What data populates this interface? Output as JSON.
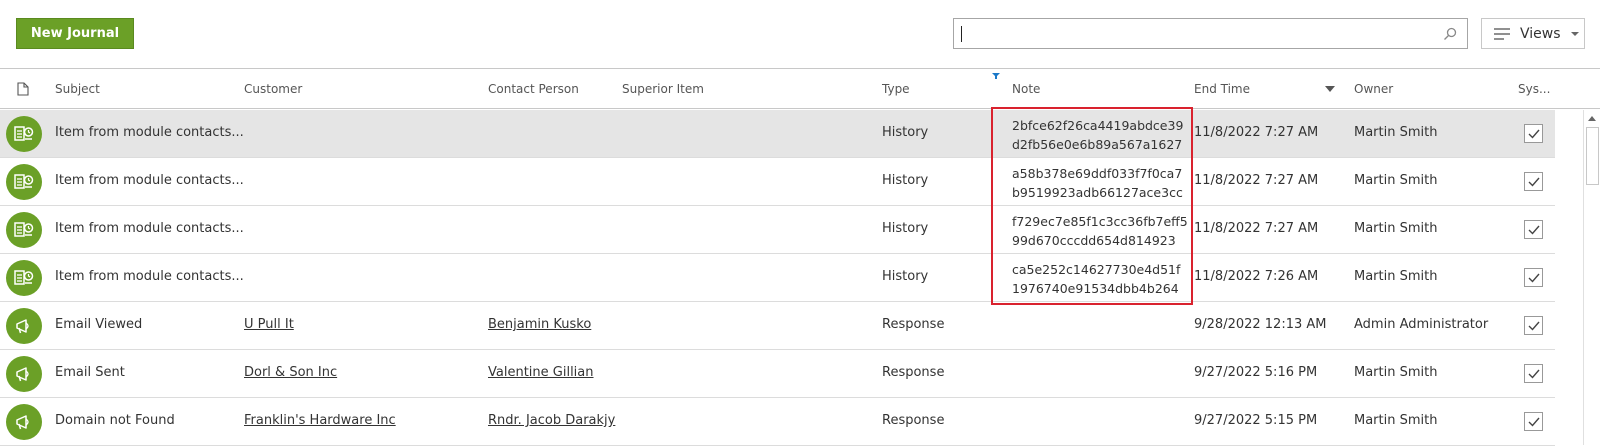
{
  "toolbar": {
    "new_button": "New Journal",
    "search": {
      "value": "",
      "placeholder": ""
    },
    "views_label": "Views"
  },
  "columns": [
    "Subject",
    "Customer",
    "Contact Person",
    "Superior Item",
    "Type",
    "Note",
    "End Time",
    "Owner",
    "Sys..."
  ],
  "rows": [
    {
      "icon": "history-journal-icon",
      "subject": "Item from module contacts...",
      "customer": "",
      "contact": "",
      "superior": "",
      "type": "History",
      "note": "2bfce62f26ca4419abdce39d2fb56e0e6b89a567a1627",
      "note_l1": "2bfce62f26ca4419abdce39",
      "note_l2": "d2fb56e0e6b89a567a1627",
      "end_time": "11/8/2022 7:27 AM",
      "owner": "Martin Smith",
      "checked": true,
      "selected": true
    },
    {
      "icon": "history-journal-icon",
      "subject": "Item from module contacts...",
      "customer": "",
      "contact": "",
      "superior": "",
      "type": "History",
      "note_l1": "a58b378e69ddf033f7f0ca7",
      "note_l2": "b9519923adb66127ace3cc",
      "end_time": "11/8/2022 7:27 AM",
      "owner": "Martin Smith",
      "checked": true,
      "selected": false
    },
    {
      "icon": "history-journal-icon",
      "subject": "Item from module contacts...",
      "customer": "",
      "contact": "",
      "superior": "",
      "type": "History",
      "note_l1": "f729ec7e85f1c3cc36fb7eff5",
      "note_l2": "99d670cccdd654d814923",
      "end_time": "11/8/2022 7:27 AM",
      "owner": "Martin Smith",
      "checked": true,
      "selected": false
    },
    {
      "icon": "history-journal-icon",
      "subject": "Item from module contacts...",
      "customer": "",
      "contact": "",
      "superior": "",
      "type": "History",
      "note_l1": "ca5e252c14627730e4d51f",
      "note_l2": "1976740e91534dbb4b264",
      "end_time": "11/8/2022 7:26 AM",
      "owner": "Martin Smith",
      "checked": true,
      "selected": false
    },
    {
      "icon": "megaphone-icon",
      "subject": "Email Viewed",
      "customer": "U Pull It",
      "contact": "Benjamin Kusko",
      "superior": "",
      "type": "Response",
      "note_l1": "",
      "note_l2": "",
      "end_time": "9/28/2022 12:13 AM",
      "owner": "Admin Administrator",
      "checked": true,
      "selected": false
    },
    {
      "icon": "megaphone-icon",
      "subject": "Email Sent",
      "customer": "Dorl & Son Inc",
      "contact": "Valentine Gillian",
      "superior": "",
      "type": "Response",
      "note_l1": "",
      "note_l2": "",
      "end_time": "9/27/2022 5:16 PM",
      "owner": "Martin Smith",
      "checked": true,
      "selected": false
    },
    {
      "icon": "megaphone-icon",
      "subject": "Domain not Found",
      "customer": "Franklin's Hardware Inc",
      "contact": "Rndr. Jacob Darakjy",
      "superior": "",
      "type": "Response",
      "note_l1": "",
      "note_l2": "",
      "end_time": "9/27/2022 5:15 PM",
      "owner": "Martin Smith",
      "checked": true,
      "selected": false
    }
  ],
  "colors": {
    "accent": "#6ba027",
    "highlight": "#d9222e",
    "selected_row": "#e5e5e5"
  }
}
